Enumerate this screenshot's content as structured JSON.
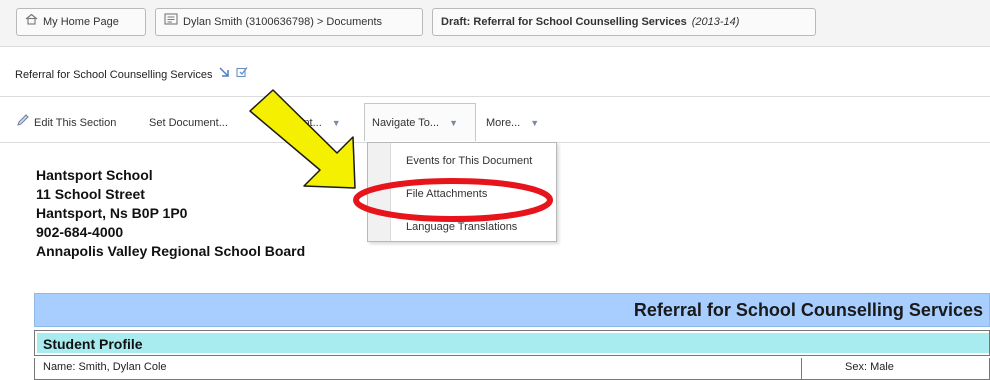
{
  "breadcrumbs": [
    {
      "label": "My Home Page",
      "icon": "home-icon"
    },
    {
      "label": "Dylan Smith (3100636798) > Documents",
      "icon": "document-icon"
    },
    {
      "label": "Draft: Referral for School Counselling Services",
      "suffix": "(2013-14)"
    }
  ],
  "document_title": "Referral for School Counselling Services",
  "toolbar": {
    "edit_section": "Edit This Section",
    "set_document": "Set Document...",
    "print": "Print...",
    "navigate_to": "Navigate To...",
    "more": "More..."
  },
  "navigate_menu": {
    "items": [
      "Events for This Document",
      "File Attachments",
      "Language Translations"
    ]
  },
  "school": {
    "name": "Hantsport School",
    "street": "11 School Street",
    "city": "Hantsport, Ns B0P 1P0",
    "phone": "902-684-4000",
    "board": "Annapolis Valley Regional School Board"
  },
  "form": {
    "title": "Referral for School Counselling Services",
    "section": "Student Profile",
    "name_label": "Name:",
    "name_value": "Smith, Dylan Cole",
    "sex_label": "Sex:",
    "sex_value": "Male"
  },
  "colors": {
    "form_header": "#a7ceff",
    "section_header": "#a9ecef",
    "highlight_arrow": "#f5f000",
    "highlight_circle": "#e8141b"
  }
}
